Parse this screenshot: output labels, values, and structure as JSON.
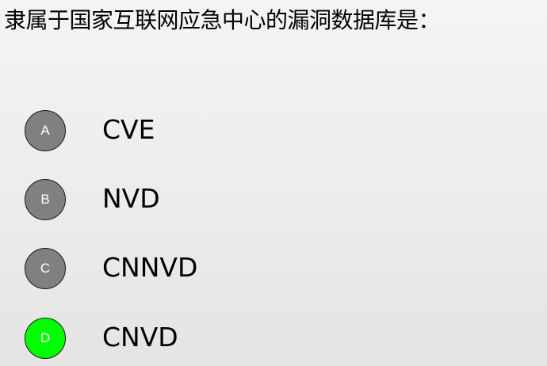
{
  "question": {
    "text": "隶属于国家互联网应急中心的漏洞数据库是："
  },
  "options": [
    {
      "letter": "A",
      "label": "CVE",
      "selected": false
    },
    {
      "letter": "B",
      "label": "NVD",
      "selected": false
    },
    {
      "letter": "C",
      "label": "CNNVD",
      "selected": false
    },
    {
      "letter": "D",
      "label": "CNVD",
      "selected": true
    }
  ],
  "colors": {
    "option_default": "#808080",
    "option_selected": "#00ff00"
  }
}
